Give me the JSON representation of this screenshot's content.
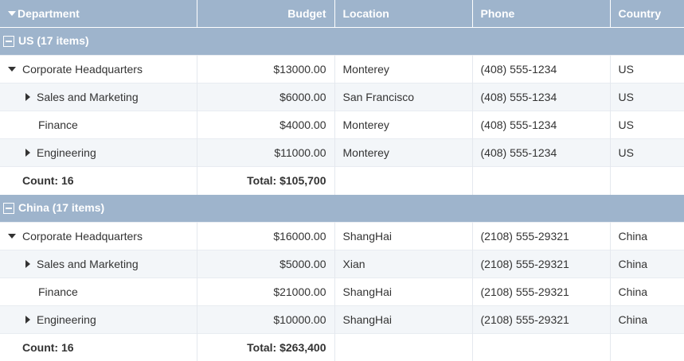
{
  "columns": {
    "department": "Department",
    "budget": "Budget",
    "location": "Location",
    "phone": "Phone",
    "country": "Country"
  },
  "groups": [
    {
      "label": "US (17 items)",
      "rows": [
        {
          "department": "Corporate Headquarters",
          "budget": "$13000.00",
          "location": "Monterey",
          "phone": "(408) 555-1234",
          "country": "US"
        },
        {
          "department": "Sales and Marketing",
          "budget": "$6000.00",
          "location": "San Francisco",
          "phone": "(408) 555-1234",
          "country": "US"
        },
        {
          "department": "Finance",
          "budget": "$4000.00",
          "location": "Monterey",
          "phone": "(408) 555-1234",
          "country": "US"
        },
        {
          "department": "Engineering",
          "budget": "$11000.00",
          "location": "Monterey",
          "phone": "(408) 555-1234",
          "country": "US"
        }
      ],
      "summary": {
        "count": "Count: 16",
        "total": "Total: $105,700"
      }
    },
    {
      "label": "China (17 items)",
      "rows": [
        {
          "department": "Corporate Headquarters",
          "budget": "$16000.00",
          "location": "ShangHai",
          "phone": "(2108) 555-29321",
          "country": "China"
        },
        {
          "department": "Sales and Marketing",
          "budget": "$5000.00",
          "location": "Xian",
          "phone": "(2108) 555-29321",
          "country": "China"
        },
        {
          "department": "Finance",
          "budget": "$21000.00",
          "location": "ShangHai",
          "phone": "(2108) 555-29321",
          "country": "China"
        },
        {
          "department": "Engineering",
          "budget": "$10000.00",
          "location": "ShangHai",
          "phone": "(2108) 555-29321",
          "country": "China"
        }
      ],
      "summary": {
        "count": "Count: 16",
        "total": "Total: $263,400"
      }
    }
  ],
  "colors": {
    "header_bg": "#9eb4cc",
    "alt_row_bg": "#f3f6f9"
  }
}
